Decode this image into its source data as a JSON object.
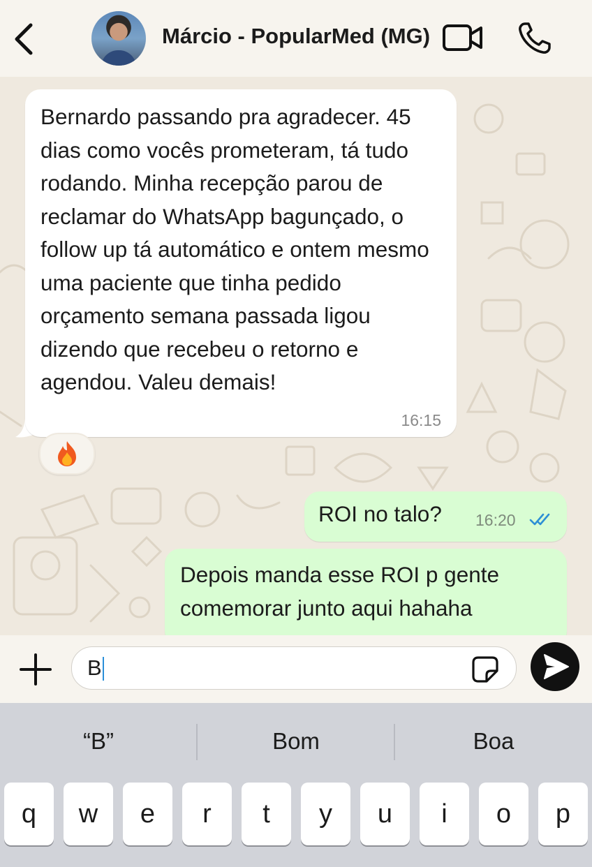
{
  "header": {
    "contact_name": "Márcio - PopularMed (MG)",
    "icons": [
      "chevron-left-icon",
      "avatar",
      "video-camera-icon",
      "phone-icon"
    ]
  },
  "messages": [
    {
      "direction": "incoming",
      "text": "Bernardo passando pra agradecer. 45 dias como vocês prometeram, tá tudo rodando. Minha recepção parou de reclamar do WhatsApp bagunçado, o follow up tá automático e ontem mesmo uma paciente que tinha pedido orçamento semana passada ligou dizendo que recebeu o retorno e agendou. Valeu demais!",
      "time": "16:15",
      "reaction": "🔥"
    },
    {
      "direction": "outgoing",
      "text": "ROI no talo?",
      "time": "16:20",
      "status": "read"
    },
    {
      "direction": "outgoing",
      "text": "Depois manda esse ROI p gente comemorar junto aqui hahaha"
    }
  ],
  "composer": {
    "value": "B",
    "icons": [
      "plus-icon",
      "sticker-icon",
      "send-icon"
    ]
  },
  "keyboard": {
    "suggestions": [
      "“B”",
      "Bom",
      "Boa"
    ],
    "keys": [
      "q",
      "w",
      "e",
      "r",
      "t",
      "y",
      "u",
      "i",
      "o",
      "p"
    ]
  },
  "colors": {
    "chat_background": "#efe9df",
    "incoming_bubble": "#ffffff",
    "outgoing_bubble": "#d9fdd3",
    "read_ticks": "#53bdeb",
    "keyboard_background": "#d1d3d9"
  }
}
